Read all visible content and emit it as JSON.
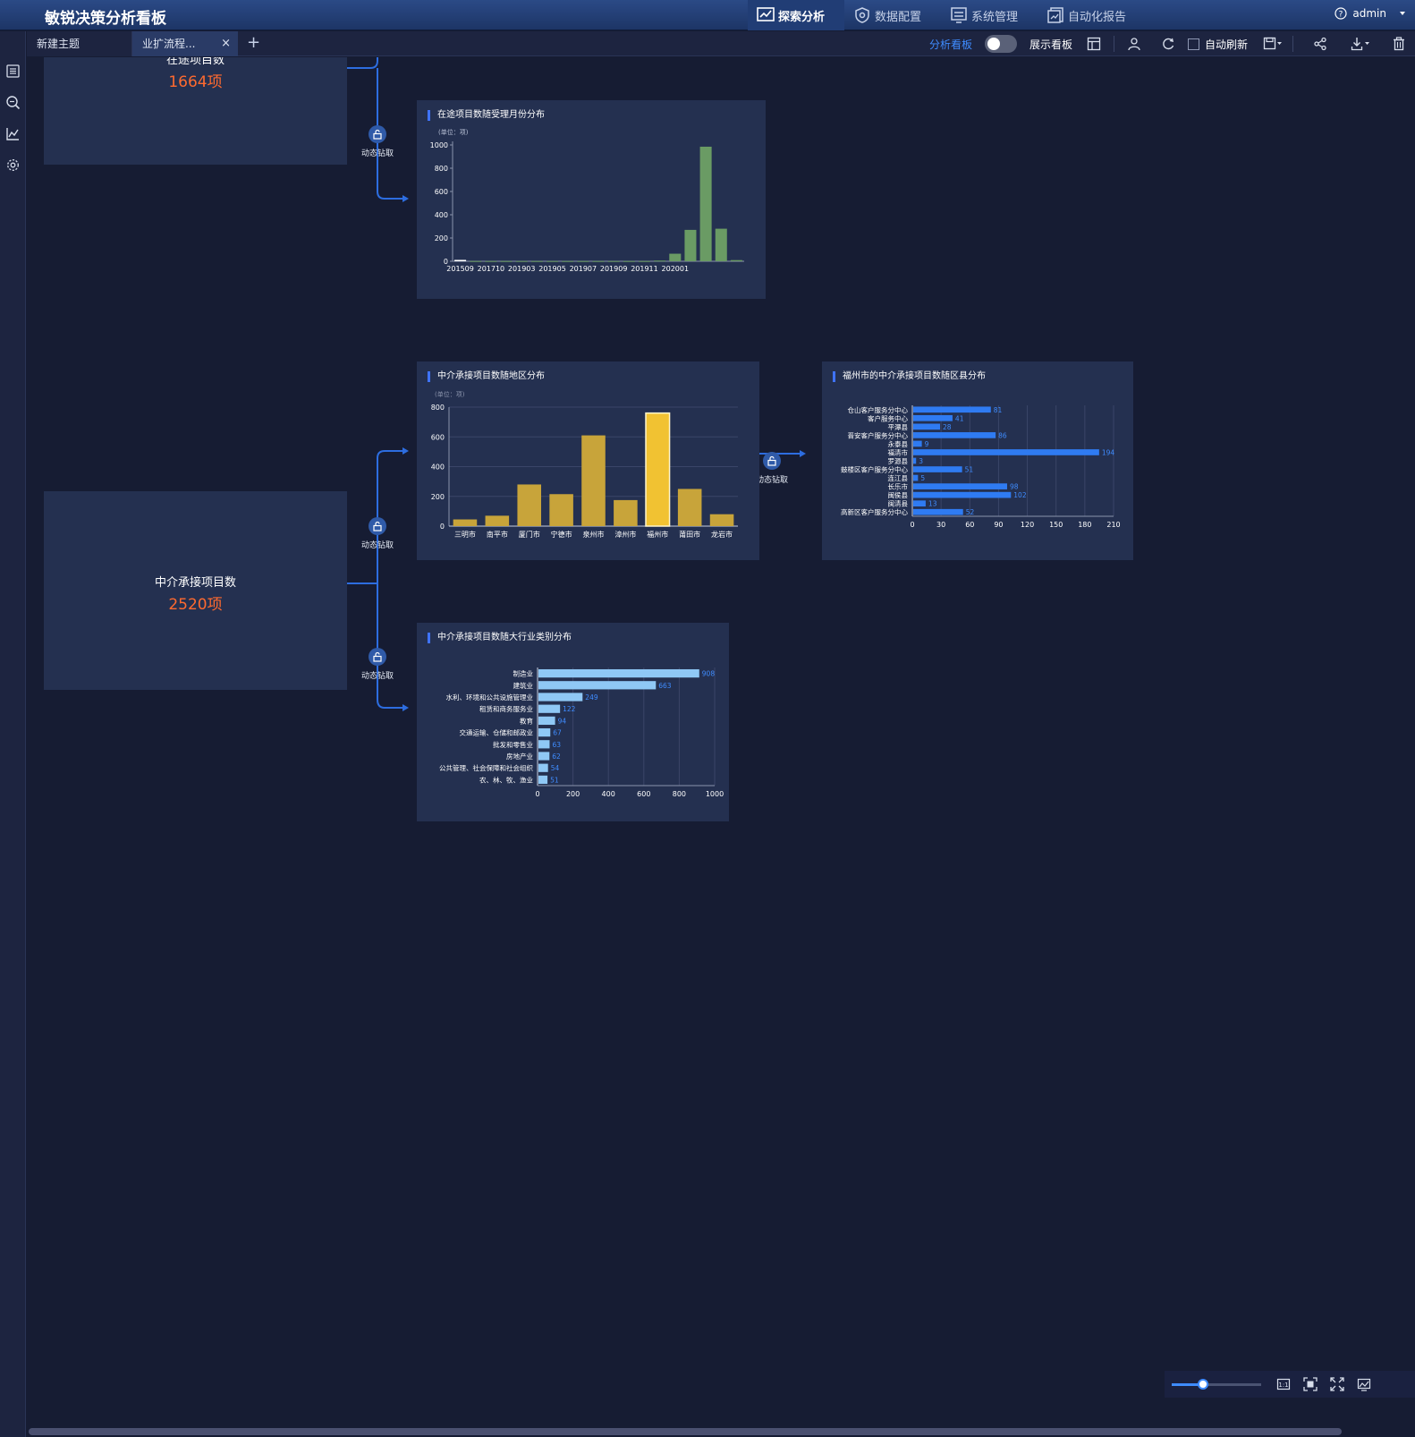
{
  "app": {
    "title": "敏锐决策分析看板"
  },
  "topnav": [
    {
      "label": "探索分析",
      "icon": "chart-line-icon",
      "active": true
    },
    {
      "label": "数据配置",
      "icon": "gear-shield-icon",
      "active": false
    },
    {
      "label": "系统管理",
      "icon": "sliders-icon",
      "active": false
    },
    {
      "label": "自动化报告",
      "icon": "report-icon",
      "active": false
    }
  ],
  "user": {
    "name": "admin"
  },
  "tabs": [
    {
      "label": "新建主题"
    },
    {
      "label": "业扩流程...",
      "close": "×"
    }
  ],
  "tab_add": "+",
  "toolbar": {
    "analysis_label": "分析看板",
    "display_label": "展示看板",
    "auto_refresh_label": "自动刷新"
  },
  "nodes": {
    "in_progress": {
      "title": "在途项目数",
      "value": "1664项"
    },
    "agency": {
      "title": "中介承接项目数",
      "value": "2520项"
    }
  },
  "drill_label": "动态钻取",
  "colors": {
    "green": "#6a9b64",
    "gold": "#c8a43a",
    "gold_highlight": "#f1c232",
    "blue": "#2f7bf2",
    "light_blue": "#8fc8f5",
    "accent": "#3f73ff"
  },
  "chart_data": [
    {
      "type": "bar",
      "title": "在途项目数随受理月份分布",
      "unit_note": "(单位：项)",
      "ylim": [
        0,
        1000
      ],
      "yticks": [
        0,
        200,
        400,
        600,
        800,
        1000
      ],
      "tick_labels": [
        "201509",
        "201710",
        "201903",
        "201905",
        "201907",
        "201909",
        "201911",
        "202001"
      ],
      "values": [
        12,
        2,
        2,
        2,
        2,
        2,
        2,
        2,
        2,
        2,
        2,
        2,
        2,
        6,
        65,
        270,
        985,
        280,
        10
      ],
      "color": "#6a9b64"
    },
    {
      "type": "bar",
      "title": "中介承接项目数随地区分布",
      "unit_note": "(单位：项)",
      "ylim": [
        0,
        800
      ],
      "yticks": [
        0,
        200,
        400,
        600,
        800
      ],
      "categories": [
        "三明市",
        "南平市",
        "厦门市",
        "宁德市",
        "泉州市",
        "漳州市",
        "福州市",
        "莆田市",
        "龙岩市"
      ],
      "values": [
        45,
        70,
        280,
        215,
        610,
        175,
        760,
        250,
        80
      ],
      "highlight": "福州市"
    },
    {
      "type": "bar",
      "orientation": "horizontal",
      "title": "福州市的中介承接项目数随区县分布",
      "xlim": [
        0,
        210
      ],
      "xticks": [
        0,
        30,
        60,
        90,
        120,
        150,
        180,
        210
      ],
      "categories": [
        "仓山客户服务分中心",
        "客户服务中心",
        "平潭县",
        "晋安客户服务分中心",
        "永泰县",
        "福清市",
        "罗源县",
        "鼓楼区客户服务分中心",
        "连江县",
        "长乐市",
        "闽侯县",
        "闽清县",
        "高新区客户服务分中心"
      ],
      "values": [
        81,
        41,
        28,
        86,
        9,
        194,
        3,
        51,
        5,
        98,
        102,
        13,
        52
      ]
    },
    {
      "type": "bar",
      "orientation": "horizontal",
      "title": "中介承接项目数随大行业类别分布",
      "xlim": [
        0,
        1000
      ],
      "xticks": [
        0,
        200,
        400,
        600,
        800,
        1000
      ],
      "categories": [
        "制造业",
        "建筑业",
        "水利、环境和公共设施管理业",
        "租赁和商务服务业",
        "教育",
        "交通运输、仓储和邮政业",
        "批发和零售业",
        "房地产业",
        "公共管理、社会保障和社会组织",
        "农、林、牧、渔业"
      ],
      "values": [
        908,
        663,
        249,
        122,
        94,
        67,
        63,
        62,
        54,
        51
      ]
    }
  ]
}
